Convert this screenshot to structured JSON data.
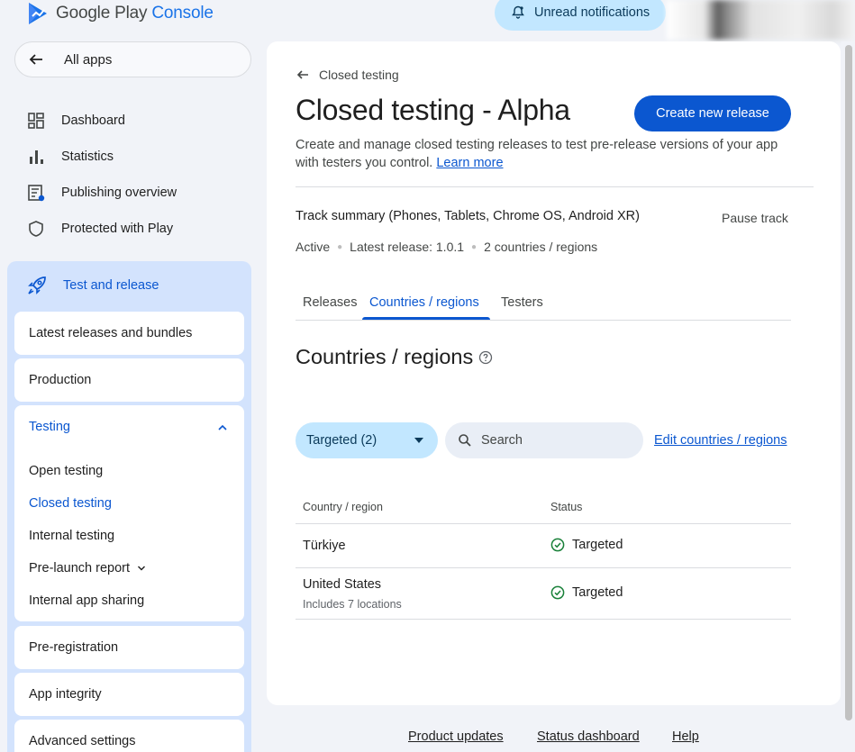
{
  "app": {
    "logo_text_plain": "Google Play ",
    "logo_text_accent": "Console"
  },
  "header": {
    "notifications_label": "Unread notifications"
  },
  "sidebar": {
    "all_apps_label": "All apps",
    "items": [
      {
        "label": "Dashboard",
        "icon": "dashboard-icon"
      },
      {
        "label": "Statistics",
        "icon": "bar-chart-icon"
      },
      {
        "label": "Publishing overview",
        "icon": "publishing-icon"
      },
      {
        "label": "Protected with Play",
        "icon": "shield-icon"
      }
    ],
    "test_release": {
      "label": "Test and release",
      "icon": "rocket-icon",
      "cards": [
        "Latest releases and bundles",
        "Production"
      ],
      "testing": {
        "label": "Testing",
        "children": [
          "Open testing",
          "Closed testing",
          "Internal testing",
          "Pre-launch report",
          "Internal app sharing"
        ],
        "active": "Closed testing"
      },
      "more_cards": [
        "Pre-registration",
        "App integrity",
        "Advanced settings"
      ]
    }
  },
  "main": {
    "breadcrumb": "Closed testing",
    "title": "Closed testing - Alpha",
    "create_button": "Create new release",
    "description": "Create and manage closed testing releases to test pre-release versions of your app with testers you control.",
    "learn_more": "Learn more",
    "track_summary": "Track summary (Phones, Tablets, Chrome OS, Android XR)",
    "pause_track": "Pause track",
    "track_status": "Active",
    "latest_release": "Latest release: 1.0.1",
    "countries_count": "2 countries / regions",
    "tabs": [
      {
        "label": "Releases",
        "active": false
      },
      {
        "label": "Countries / regions",
        "active": true
      },
      {
        "label": "Testers",
        "active": false
      }
    ],
    "section_title": "Countries / regions",
    "filter_label": "Targeted (2)",
    "search_placeholder": "Search",
    "edit_link": "Edit countries / regions",
    "table": {
      "headers": [
        "Country / region",
        "Status"
      ],
      "rows": [
        {
          "country": "Türkiye",
          "sub": "",
          "status": "Targeted"
        },
        {
          "country": "United States",
          "sub": "Includes 7 locations",
          "status": "Targeted"
        }
      ]
    }
  },
  "footer": {
    "links": [
      "Product updates",
      "Status dashboard",
      "Help"
    ]
  },
  "colors": {
    "accent": "#0b57d0",
    "sidebar_active_bg": "#d3e3fd",
    "status_ok": "#188038"
  }
}
